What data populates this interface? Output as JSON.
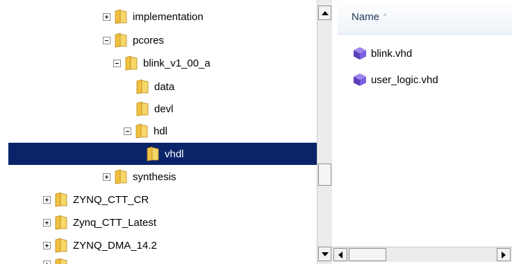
{
  "tree": {
    "items": [
      {
        "label": "implementation",
        "expander": "plus"
      },
      {
        "label": "pcores",
        "expander": "minus"
      },
      {
        "label": "blink_v1_00_a",
        "expander": "minus"
      },
      {
        "label": "data",
        "expander": "none"
      },
      {
        "label": "devl",
        "expander": "none"
      },
      {
        "label": "hdl",
        "expander": "minus"
      },
      {
        "label": "vhdl",
        "expander": "none",
        "selected": true
      },
      {
        "label": "synthesis",
        "expander": "plus"
      },
      {
        "label": "ZYNQ_CTT_CR",
        "expander": "plus"
      },
      {
        "label": "Zynq_CTT_Latest",
        "expander": "plus"
      },
      {
        "label": "ZYNQ_DMA_14.2",
        "expander": "plus"
      }
    ]
  },
  "file_list": {
    "column_header": "Name",
    "sort_indicator": "^",
    "files": [
      {
        "name": "blink.vhd",
        "icon": "vhd-file-icon"
      },
      {
        "name": "user_logic.vhd",
        "icon": "vhd-file-icon"
      }
    ]
  },
  "colors": {
    "selection_bg": "#0a246a",
    "selection_text": "#ffffff",
    "folder_yellow": "#f5c842",
    "cube_purple": "#6a48c8"
  }
}
